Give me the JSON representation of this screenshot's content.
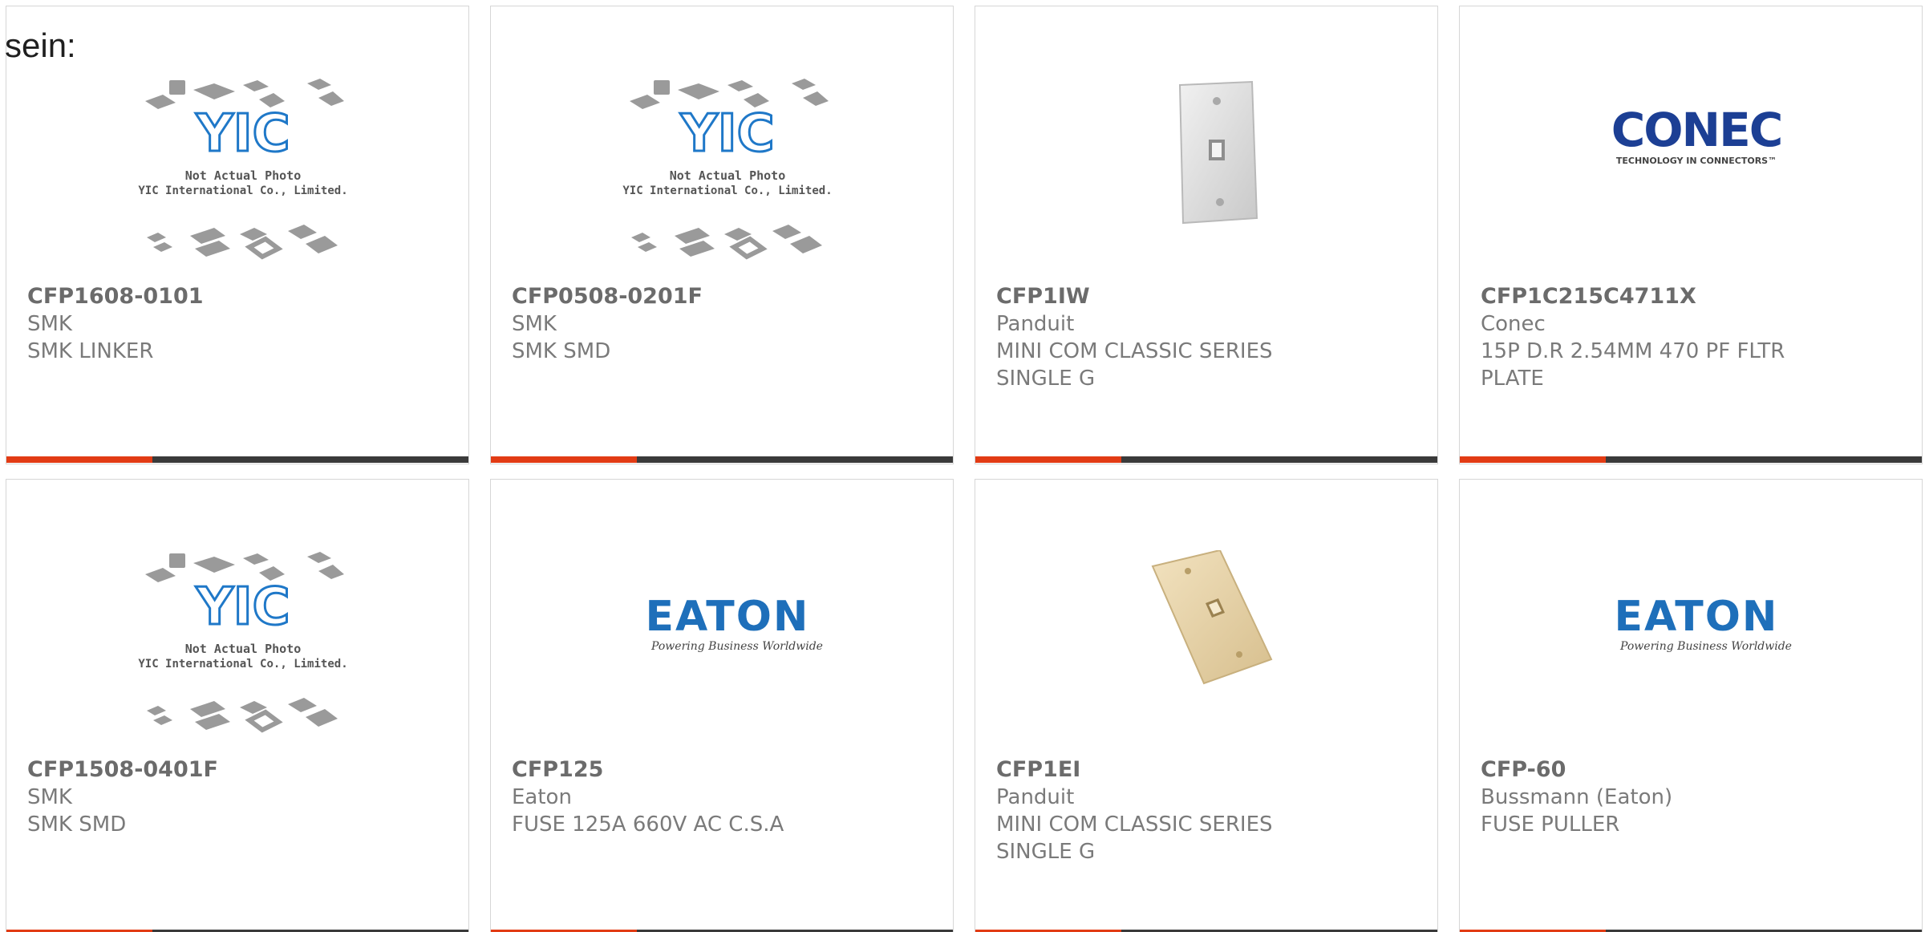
{
  "lead_text": "sein:",
  "colors": {
    "accent": "#e23b14",
    "bar": "#3a3a3a",
    "border": "#d6d6d6",
    "text": "#7a7a7a",
    "yic_blue": "#1f78c8",
    "eaton_blue": "#1e6fba",
    "conec_blue": "#1c3f94"
  },
  "products": [
    {
      "part": "CFP1608-0101",
      "manufacturer": "SMK",
      "description": "SMK LINKER",
      "image": {
        "kind": "yic-placeholder",
        "logo": "YIC",
        "line1": "Not Actual Photo",
        "line2": "YIC International Co., Limited."
      }
    },
    {
      "part": "CFP0508-0201F",
      "manufacturer": "SMK",
      "description": "SMK SMD",
      "image": {
        "kind": "yic-placeholder",
        "logo": "YIC",
        "line1": "Not Actual Photo",
        "line2": "YIC International Co., Limited."
      }
    },
    {
      "part": "CFP1IW",
      "manufacturer": "Panduit",
      "description": "MINI COM CLASSIC SERIES SINGLE G",
      "image": {
        "kind": "wall-plate-white"
      }
    },
    {
      "part": "CFP1C215C4711X",
      "manufacturer": "Conec",
      "description": "15P D.R 2.54MM 470 PF FLTR PLATE",
      "image": {
        "kind": "conec-logo",
        "logo": "CONEC",
        "tagline": "TECHNOLOGY IN CONNECTORS™"
      }
    },
    {
      "part": "CFP1508-0401F",
      "manufacturer": "SMK",
      "description": "SMK SMD",
      "image": {
        "kind": "yic-placeholder",
        "logo": "YIC",
        "line1": "Not Actual Photo",
        "line2": "YIC International Co., Limited."
      }
    },
    {
      "part": "CFP125",
      "manufacturer": "Eaton",
      "description": "FUSE 125A 660V AC C.S.A",
      "image": {
        "kind": "eaton-logo",
        "logo": "EATON",
        "tagline": "Powering Business Worldwide"
      }
    },
    {
      "part": "CFP1EI",
      "manufacturer": "Panduit",
      "description": "MINI COM CLASSIC SERIES SINGLE G",
      "image": {
        "kind": "wall-plate-ivory"
      }
    },
    {
      "part": "CFP-60",
      "manufacturer": "Bussmann (Eaton)",
      "description": "FUSE PULLER",
      "image": {
        "kind": "eaton-logo",
        "logo": "EATON",
        "tagline": "Powering Business Worldwide"
      }
    }
  ]
}
